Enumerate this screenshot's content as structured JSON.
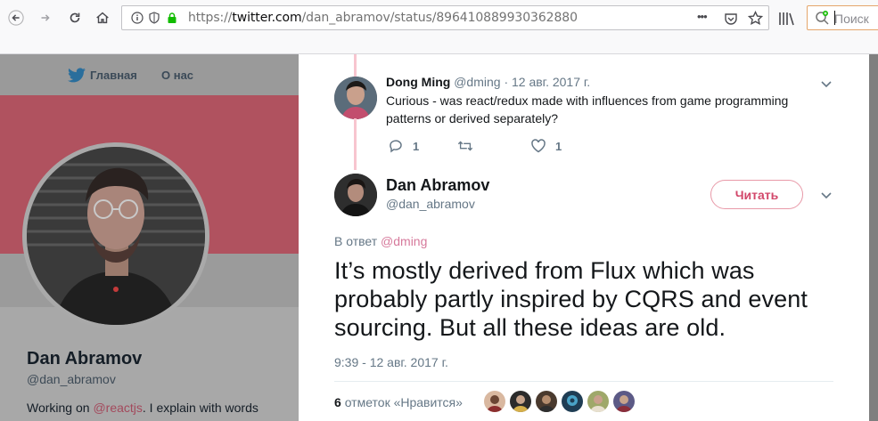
{
  "browser": {
    "url_scheme": "https://",
    "url_host": "twitter.com",
    "url_path": "/dan_abramov/status/896410889930362880",
    "search_placeholder": "Поиск",
    "dots": "•••"
  },
  "twitter_nav": {
    "home_label": "Главная",
    "about_label": "О нас"
  },
  "profile": {
    "name": "Dan Abramov",
    "handle": "@dan_abramov",
    "bio_prefix": "Working on ",
    "bio_link": "@reactjs",
    "bio_suffix": ". I explain with words"
  },
  "reply_tweet": {
    "name": "Dong Ming",
    "handle": "@dming",
    "sep": "·",
    "date": "12 авг. 2017 г.",
    "text": "Curious - was react/redux made with influences from game programming patterns or derived separately?",
    "reply_count": "1",
    "like_count": "1"
  },
  "main_tweet": {
    "name": "Dan Abramov",
    "handle": "@dan_abramov",
    "follow_label": "Читать",
    "reply_to_label": "В ответ",
    "reply_to_handle": "@dming",
    "text": "It’s mostly derived from Flux which was probably partly inspired by CQRS and event sourcing. But all these ideas are old.",
    "timestamp": "9:39 - 12 авг. 2017 г.",
    "likes_count": "6",
    "likes_label": "отметок «Нравится»"
  },
  "colors": {
    "accent": "#e0245e",
    "banner": "#b0525f",
    "thread_line": "#f7c5cf"
  }
}
